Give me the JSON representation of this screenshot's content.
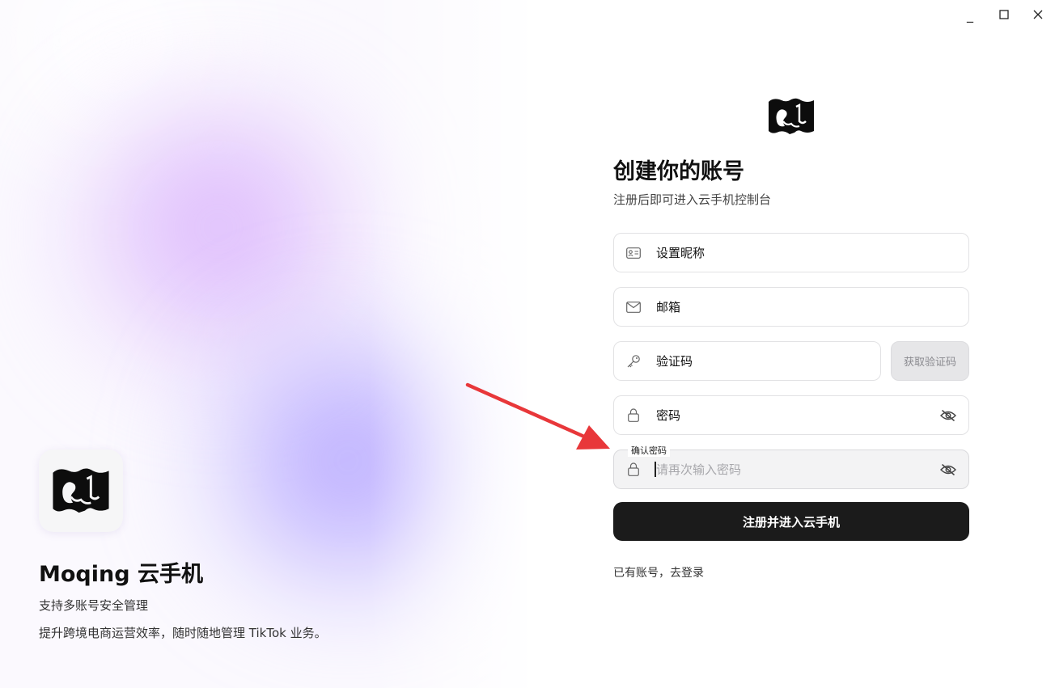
{
  "window": {
    "minimize_symbol": "_",
    "maximize_symbol": "☐",
    "close_symbol": "✕"
  },
  "hero": {
    "app_name": "Moqing 云手机",
    "line1": "支持多账号安全管理",
    "line2": "提升跨境电商运营效率，随时随地管理 TikTok 业务。"
  },
  "form": {
    "title": "创建你的账号",
    "subtitle": "注册后即可进入云手机控制台",
    "nickname": {
      "value": "设置昵称",
      "icon": "id-card-icon"
    },
    "email": {
      "value": "邮箱",
      "icon": "mail-icon"
    },
    "code": {
      "value": "验证码",
      "icon": "key-icon",
      "button_label": "获取验证码"
    },
    "password": {
      "value": "密码",
      "icon": "lock-icon",
      "toggle_icon": "eye-off-icon"
    },
    "confirm_password": {
      "label": "确认密码",
      "placeholder": "请再次输入密码",
      "icon": "lock-icon",
      "toggle_icon": "eye-off-icon"
    },
    "submit_label": "注册并进入云手机",
    "login_link": "已有账号，去登录"
  },
  "colors": {
    "primary_button": "#1b1b1b",
    "annotation_arrow": "#e8373a",
    "accent_pink": "#d6aafc",
    "accent_blue": "#a896ff"
  }
}
